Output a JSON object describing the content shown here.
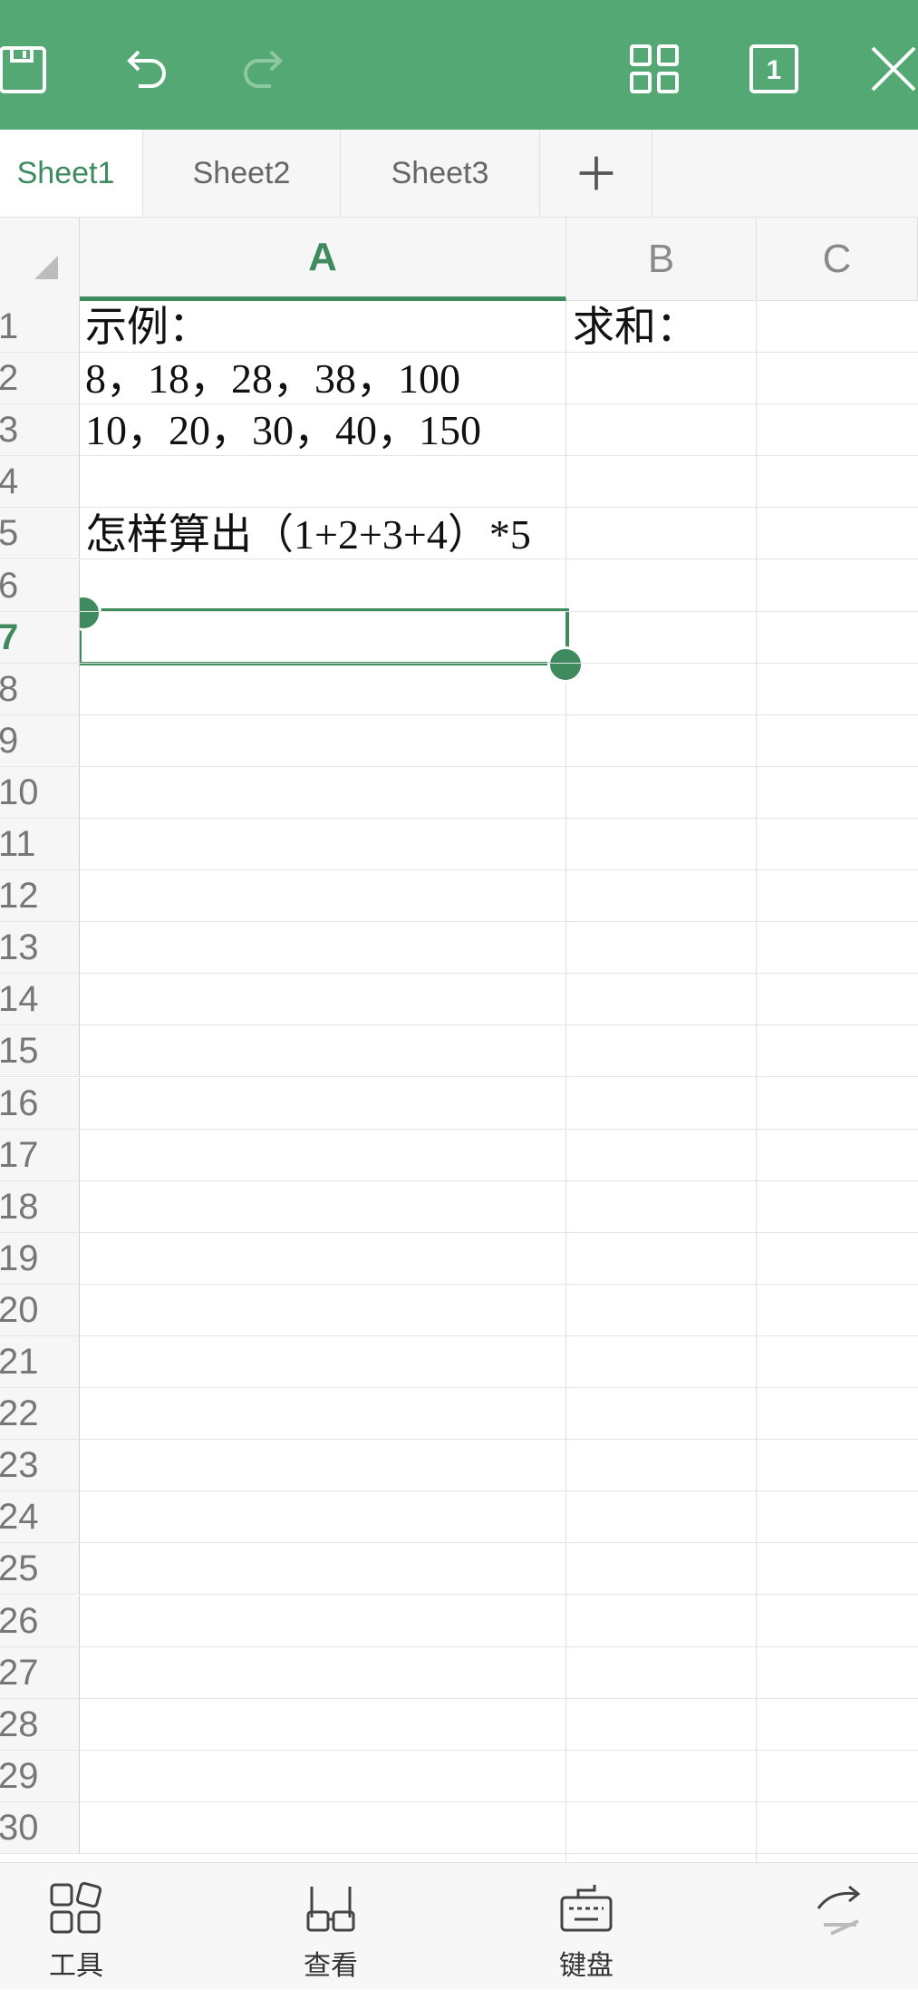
{
  "toolbar": {
    "save_icon": "save-icon",
    "undo_icon": "undo-icon",
    "redo_icon": "redo-icon",
    "grid_icon": "grid-icon",
    "page_count": "1",
    "close_icon": "close-icon",
    "accent": "#54a874"
  },
  "tabs": [
    "Sheet1",
    "Sheet2",
    "Sheet3"
  ],
  "active_tab": "Sheet1",
  "columns": [
    "A",
    "B",
    "C"
  ],
  "active_column": "A",
  "rows": [
    "1",
    "2",
    "3",
    "4",
    "5",
    "6",
    "7",
    "8",
    "9",
    "10",
    "11",
    "12",
    "13",
    "14",
    "15",
    "16",
    "17",
    "18",
    "19",
    "20",
    "21",
    "22",
    "23",
    "24",
    "25",
    "26",
    "27",
    "28",
    "29",
    "30"
  ],
  "active_row": "7",
  "cells": {
    "A1": "示例：",
    "A2": "8，18，28，38，100",
    "A3": "10，20，30，40，150",
    "A5": "怎样算出（1+2+3+4）*5",
    "B1": "求和："
  },
  "bottom_bar": {
    "tools": "工具",
    "view": "查看",
    "keyboard": "键盘"
  }
}
